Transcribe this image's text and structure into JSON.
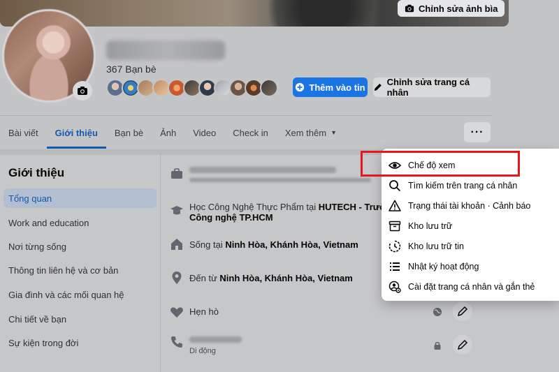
{
  "cover": {
    "edit_label": "Chỉnh sửa ảnh bìa"
  },
  "profile": {
    "friends_count": "367 Bạn bè",
    "add_story_label": "Thêm vào tin",
    "edit_profile_label": "Chỉnh sửa trang cá nhân"
  },
  "tabs": [
    {
      "label": "Bài viết"
    },
    {
      "label": "Giới thiệu",
      "active": true
    },
    {
      "label": "Bạn bè"
    },
    {
      "label": "Ảnh"
    },
    {
      "label": "Video"
    },
    {
      "label": "Check in"
    },
    {
      "label": "Xem thêm"
    }
  ],
  "more_button_label": "···",
  "about": {
    "title": "Giới thiệu",
    "nav": [
      {
        "label": "Tổng quan",
        "active": true
      },
      {
        "label": "Work and education"
      },
      {
        "label": "Nơi từng sống"
      },
      {
        "label": "Thông tin liên hệ và cơ bản"
      },
      {
        "label": "Gia đình và các mối quan hệ"
      },
      {
        "label": "Chi tiết về bạn"
      },
      {
        "label": "Sự kiện trong đời"
      }
    ],
    "rows": {
      "education_prefix": "Học Công Nghệ Thực Phẩm tại ",
      "education_school": "HUTECH - Trường Đ",
      "education_school_line2": "Công nghệ TP.HCM",
      "lives_prefix": "Sống tại ",
      "lives_place": "Ninh Hòa, Khánh Hòa, Vietnam",
      "from_prefix": "Đến từ ",
      "from_place": "Ninh Hòa, Khánh Hòa, Vietnam",
      "dating": "Hẹn hò",
      "phone_type": "Di động"
    }
  },
  "menu": {
    "items": [
      {
        "label": "Chế độ xem",
        "icon": "eye-icon"
      },
      {
        "label": "Tìm kiếm trên trang cá nhân",
        "icon": "search-icon"
      },
      {
        "label": "Trạng thái tài khoản · Cảnh báo",
        "icon": "warning-icon"
      },
      {
        "label": "Kho lưu trữ",
        "icon": "archive-icon"
      },
      {
        "label": "Kho lưu trữ tin",
        "icon": "story-archive-icon"
      },
      {
        "label": "Nhật ký hoạt động",
        "icon": "list-icon"
      },
      {
        "label": "Cài đặt trang cá nhân và gắn thẻ",
        "icon": "profile-settings-icon"
      }
    ]
  },
  "colors": {
    "accent": "#1b74e4",
    "highlight": "#e5161c"
  }
}
